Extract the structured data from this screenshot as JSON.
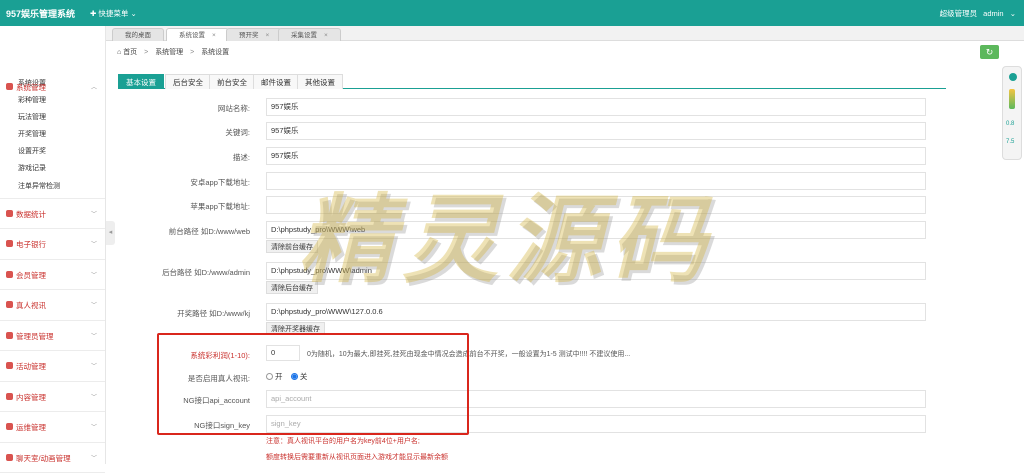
{
  "app": {
    "brand": "957娱乐管理系统",
    "quick_menu": "✚ 快捷菜单 ⌄",
    "role": "超级管理员",
    "user": "admin",
    "accent_color": "#1aa094"
  },
  "tabs": [
    {
      "label": "我的桌面",
      "closable": false
    },
    {
      "label": "系统设置",
      "closable": true
    },
    {
      "label": "预开奖",
      "closable": true
    },
    {
      "label": "采集设置",
      "closable": true
    }
  ],
  "breadcrumb": {
    "home": "首页",
    "level1": "系统管理",
    "level2": "系统设置"
  },
  "sidebar": {
    "open_section": "系统管理",
    "sub_items": [
      "系统设置",
      "彩种管理",
      "玩法管理",
      "开奖管理",
      "设置开奖",
      "游戏记录",
      "注单异常检测"
    ],
    "sections": [
      "数据统计",
      "电子银行",
      "会员管理",
      "真人视讯",
      "管理员管理",
      "活动管理",
      "内容管理",
      "运维管理",
      "聊天室/动画管理"
    ]
  },
  "subtabs": [
    "基本设置",
    "后台安全",
    "前台安全",
    "邮件设置",
    "其他设置"
  ],
  "form": {
    "site_name": {
      "label": "网站名称:",
      "value": "957娱乐"
    },
    "keywords": {
      "label": "关键词:",
      "value": "957娱乐"
    },
    "description": {
      "label": "描述:",
      "value": "957娱乐"
    },
    "android_url": {
      "label": "安卓app下载地址:",
      "value": ""
    },
    "ios_url": {
      "label": "苹果app下载地址:",
      "value": ""
    },
    "front_path": {
      "label": "前台路径 如D:/www/web",
      "value": "D:\\phpstudy_pro\\WWW\\web",
      "button": "清除前台缓存"
    },
    "admin_path": {
      "label": "后台路径 如D:/www/admin",
      "value": "D:\\phpstudy_pro\\WWW\\admin",
      "button": "清除后台缓存"
    },
    "lottery_path": {
      "label": "开奖路径 如D:/www/kj",
      "value": "D:\\phpstudy_pro\\WWW\\127.0.0.6",
      "button": "清除开奖器缓存"
    },
    "profit": {
      "label": "系统彩利润(1-10):",
      "value": "0",
      "hint": "0为随机，10为最大,即挂死,挂死由现金中情况会造成前台不开奖，一般设置为1-5 测试中!!!! 不建议使用..."
    },
    "live_video": {
      "label": "是否启用真人视讯:",
      "option_on": "开",
      "option_off": "关",
      "selected": "关"
    },
    "api_account": {
      "label": "NG接口api_account",
      "placeholder": "api_account"
    },
    "sign_key": {
      "label": "NG接口sign_key",
      "placeholder": "sign_key"
    },
    "note1": "注意：真人视讯平台的用户名为key前4位+用户名;",
    "note2": "额度转换后需要重新从视讯页面进入游戏才能显示最新余额"
  },
  "watermark": "精灵源码",
  "widget": {
    "value1": "0.8",
    "value2": "7.5"
  }
}
